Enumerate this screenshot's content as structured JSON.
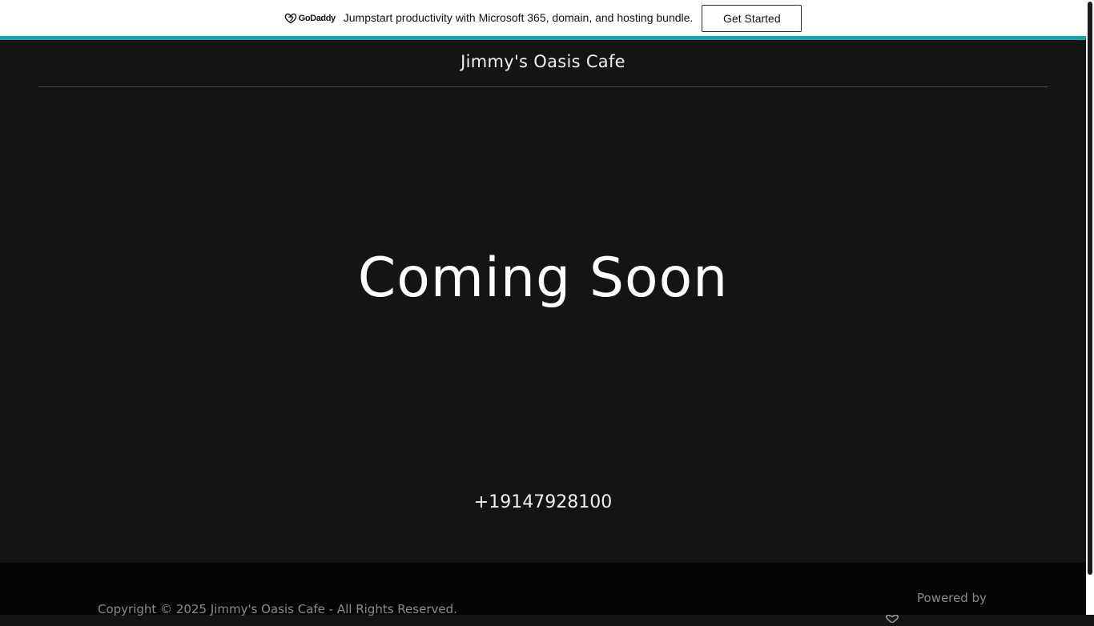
{
  "promo_banner": {
    "logo_text": "GoDaddy",
    "logo_icon": "godaddy-logo-icon",
    "message": "Jumpstart productivity with Microsoft 365, domain, and hosting bundle.",
    "cta_label": "Get Started",
    "accent_color": "#18a3a6"
  },
  "header": {
    "site_title": "Jimmy's Oasis Cafe"
  },
  "hero": {
    "heading": "Coming Soon"
  },
  "contact": {
    "phone": "+19147928100"
  },
  "footer": {
    "copyright": "Copyright © 2025 Jimmy's Oasis Cafe - All Rights Reserved.",
    "powered_by": "Powered by",
    "powered_logo_icon": "godaddy-logo-icon"
  },
  "colors": {
    "page_background": "#141414",
    "footer_background": "#050505",
    "banner_background": "#ffffff"
  }
}
